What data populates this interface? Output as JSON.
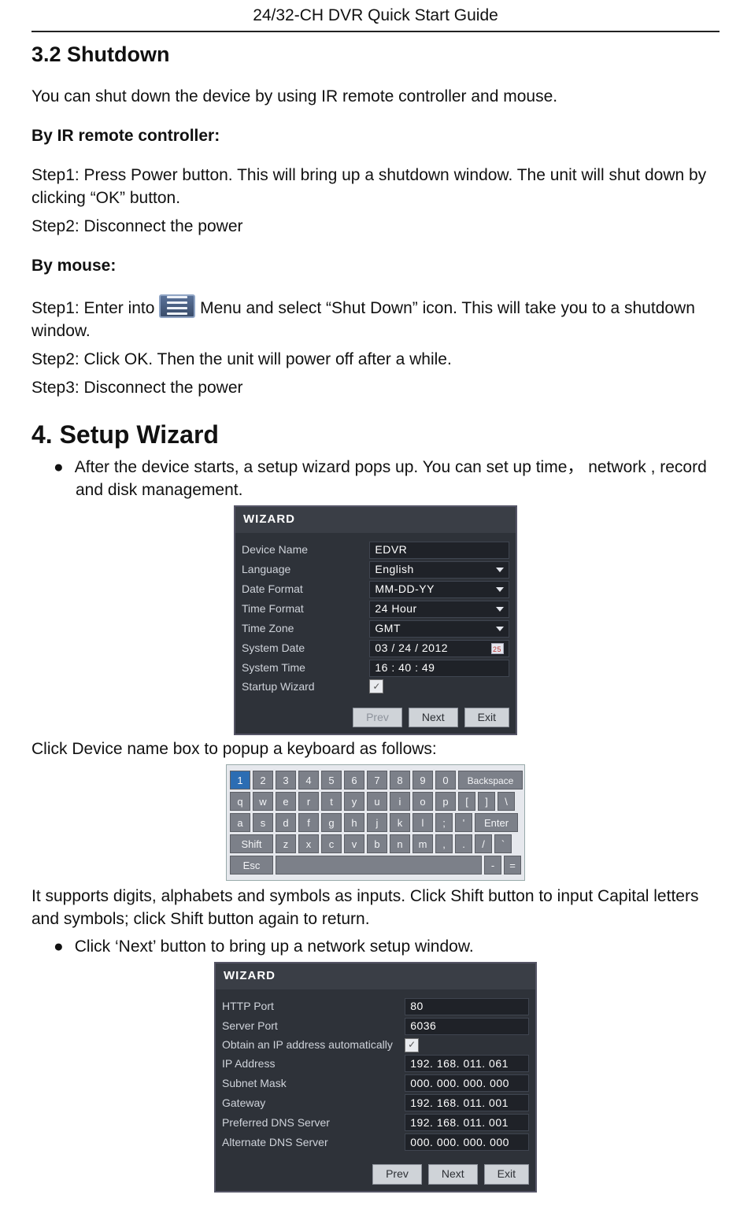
{
  "running_head": "24/32-CH DVR Quick Start Guide",
  "sec32_title": "3.2   Shutdown",
  "sec32_intro": "You can shut down the device by using IR remote controller and mouse.",
  "sec32_ir_head": "By IR remote controller:",
  "sec32_ir_s1": "Step1: Press Power button. This will bring up a shutdown window. The unit will shut down by clicking “OK” button.",
  "sec32_ir_s2": "Step2: Disconnect the power",
  "sec32_mouse_head": "By mouse:",
  "sec32_mouse_s1a": "Step1: Enter into ",
  "sec32_mouse_s1b": " Menu and select “Shut Down” icon. This will take you to a shutdown window.",
  "sec32_mouse_s2": "Step2: Click OK. Then the unit will power off after a while.",
  "sec32_mouse_s3": "Step3: Disconnect the power",
  "sec4_title": "4. Setup Wizard",
  "sec4_after": "After the device starts, a setup wizard pops up. You can set up time， network , record and disk management.",
  "wizard1": {
    "title": "WIZARD",
    "rows": {
      "device_name": {
        "lbl": "Device Name",
        "val": "EDVR"
      },
      "language": {
        "lbl": "Language",
        "val": "English"
      },
      "date_format": {
        "lbl": "Date Format",
        "val": "MM-DD-YY"
      },
      "time_format": {
        "lbl": "Time Format",
        "val": "24 Hour"
      },
      "time_zone": {
        "lbl": "Time Zone",
        "val": "GMT"
      },
      "system_date": {
        "lbl": "System Date",
        "val": "03 / 24 / 2012"
      },
      "system_time": {
        "lbl": "System Time",
        "val": "16 : 40 : 49"
      },
      "startup": {
        "lbl": "Startup Wizard"
      }
    },
    "buttons": {
      "prev": "Prev",
      "next": "Next",
      "exit": "Exit"
    }
  },
  "after_wizard1": "Click Device name box to popup a keyboard as follows:",
  "kbd": {
    "r1": [
      "1",
      "2",
      "3",
      "4",
      "5",
      "6",
      "7",
      "8",
      "9",
      "0",
      "Backspace"
    ],
    "r2": [
      "q",
      "w",
      "e",
      "r",
      "t",
      "y",
      "u",
      "i",
      "o",
      "p",
      "[",
      "]",
      "\\"
    ],
    "r3": [
      "a",
      "s",
      "d",
      "f",
      "g",
      "h",
      "j",
      "k",
      "l",
      ";",
      "'",
      "Enter"
    ],
    "r4": [
      "Shift",
      "z",
      "x",
      "c",
      "v",
      "b",
      "n",
      "m",
      ",",
      ".",
      "/",
      "`"
    ],
    "r5": [
      "Esc",
      "-",
      "="
    ]
  },
  "kbd_para": "It supports digits, alphabets and symbols as inputs. Click Shift button to input Capital letters and symbols; click Shift button again to return.",
  "next_bullet": "Click ‘Next’ button to bring up a network setup window.",
  "wizard2": {
    "title": "WIZARD",
    "rows": {
      "http_port": {
        "lbl": "HTTP Port",
        "val": "80"
      },
      "server_port": {
        "lbl": "Server Port",
        "val": "6036"
      },
      "auto_ip": {
        "lbl": "Obtain an IP address automatically"
      },
      "ip": {
        "lbl": "IP Address",
        "val": "192. 168. 011. 061"
      },
      "mask": {
        "lbl": "Subnet Mask",
        "val": "000. 000. 000. 000"
      },
      "gw": {
        "lbl": "Gateway",
        "val": "192. 168. 011. 001"
      },
      "dns1": {
        "lbl": "Preferred DNS Server",
        "val": "192. 168. 011. 001"
      },
      "dns2": {
        "lbl": "Alternate DNS Server",
        "val": "000. 000. 000. 000"
      }
    },
    "buttons": {
      "prev": "Prev",
      "next": "Next",
      "exit": "Exit"
    }
  }
}
